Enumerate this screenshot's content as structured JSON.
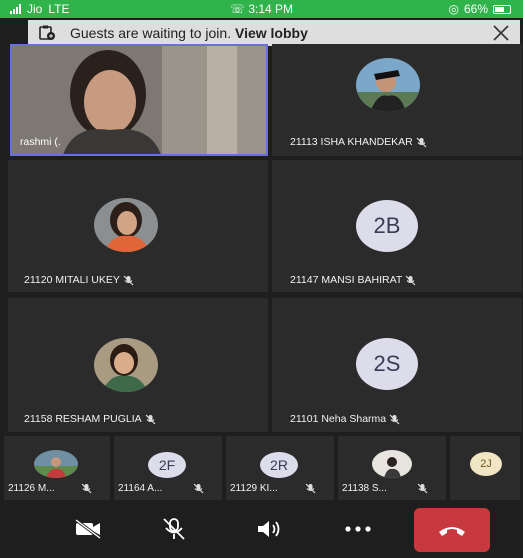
{
  "status_bar": {
    "carrier": "Jio",
    "network": "LTE",
    "time": "3:14 PM",
    "battery": "66%",
    "battery_level": 0.66
  },
  "lobby_banner": {
    "message": "Guests are waiting to join.",
    "action": "View lobby"
  },
  "self_view": {
    "name": "rashmi (."
  },
  "participants": [
    {
      "name": "21113 ISHA KHANDEKAR",
      "avatar": "photo",
      "muted": true
    },
    {
      "name": "21120 MITALI UKEY",
      "avatar": "photo",
      "muted": true
    },
    {
      "name": "21147 MANSI BAHIRAT",
      "avatar": "initials",
      "initials": "2B",
      "muted": true
    },
    {
      "name": "21158 RESHAM PUGLIA",
      "avatar": "photo",
      "muted": true
    },
    {
      "name": "21101 Neha Sharma",
      "avatar": "initials",
      "initials": "2S",
      "muted": true
    }
  ],
  "strip": [
    {
      "name": "21126 M...",
      "avatar": "photo",
      "muted": true
    },
    {
      "name": "21164 A...",
      "avatar": "initials",
      "initials": "2F",
      "muted": true
    },
    {
      "name": "21129 KI...",
      "avatar": "initials",
      "initials": "2R",
      "muted": true
    },
    {
      "name": "21138 S...",
      "avatar": "photo",
      "muted": true
    },
    {
      "name": "",
      "avatar": "initials",
      "initials": "2J",
      "muted": false
    }
  ],
  "colors": {
    "status_bar": "#2fb34a",
    "hangup": "#c8383f",
    "self_view_border": "#6a6fe0",
    "avatar_bg": "#dcdcea"
  }
}
